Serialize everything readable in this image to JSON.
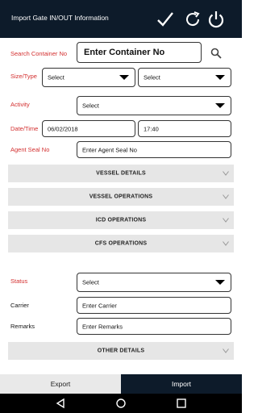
{
  "header": {
    "title": "Import Gate IN/OUT Information"
  },
  "form": {
    "search_container_label": "Search Container No",
    "container_placeholder": "Enter Container No",
    "size_type_label": "Size/Type",
    "size_value": "Select",
    "type_value": "Select",
    "activity_label": "Activity",
    "activity_value": "Select",
    "datetime_label": "Date/Time",
    "date_value": "06/02/2018",
    "time_value": "17:40",
    "agent_seal_label": "Agent Seal No",
    "agent_seal_placeholder": "Enter Agent Seal No",
    "status_label": "Status",
    "status_value": "Select",
    "carrier_label": "Carrier",
    "carrier_placeholder": "Enter Carrier",
    "remarks_label": "Remarks",
    "remarks_placeholder": "Enter Remarks"
  },
  "sections": {
    "vessel_details": "VESSEL DETAILS",
    "vessel_operations": "VESSEL OPERATIONS",
    "icd_operations": "ICD OPERATIONS",
    "cfs_operations": "CFS OPERATIONS",
    "other_details": "OTHER DETAILS"
  },
  "tabs": {
    "export": "Export",
    "import": "Import"
  },
  "colors": {
    "appbar": "#0d1b2a",
    "required_label": "#d32f2f",
    "section_bg": "#e6e6e6",
    "active_tab": "#0d1b2a"
  },
  "icons": [
    "check-icon",
    "refresh-icon",
    "power-icon",
    "search-icon",
    "chevron-down-icon",
    "back-icon",
    "home-icon",
    "recents-icon"
  ]
}
